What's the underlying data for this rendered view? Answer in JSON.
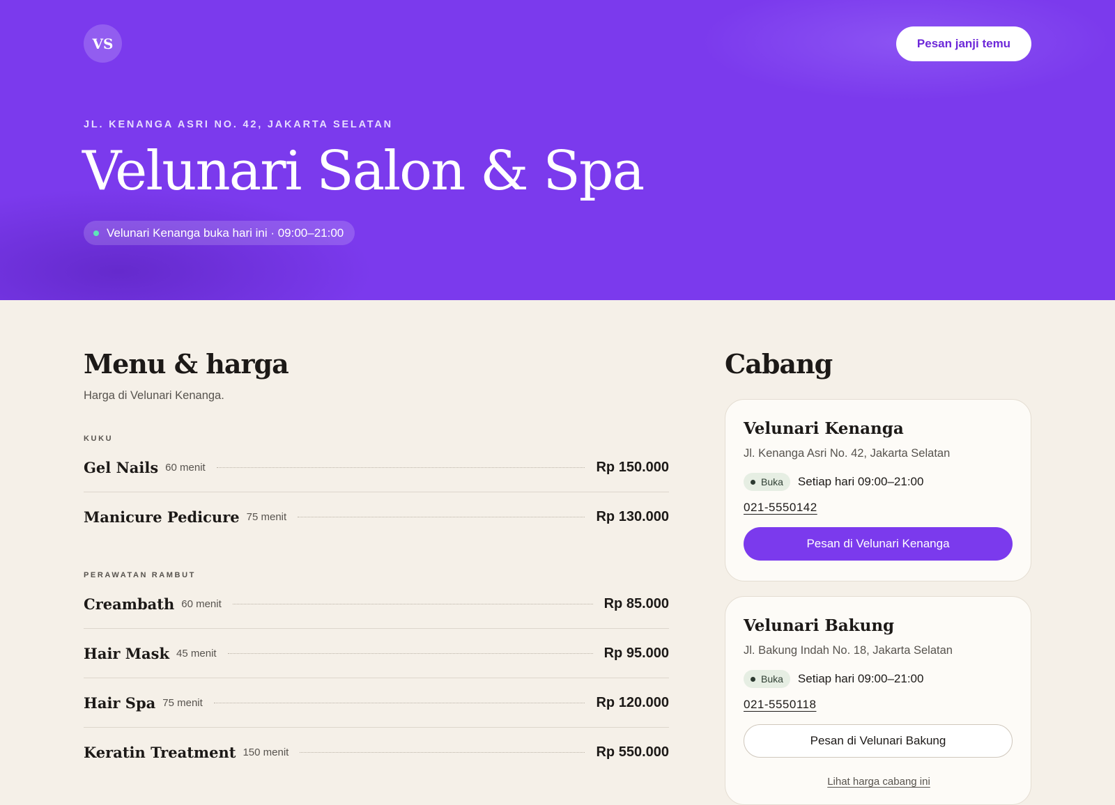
{
  "header": {
    "logo_text": "VS",
    "book_button": "Pesan janji temu",
    "address": "JL. KENANGA ASRI NO. 42, JAKARTA SELATAN",
    "title": "Velunari Salon & Spa",
    "open_status": "Velunari Kenanga buka hari ini · 09:00–21:00"
  },
  "menu": {
    "title": "Menu & harga",
    "subtitle": "Harga di Velunari Kenanga.",
    "categories": [
      {
        "label": "KUKU",
        "items": [
          {
            "name": "Gel Nails",
            "duration": "60 menit",
            "price": "Rp 150.000"
          },
          {
            "name": "Manicure Pedicure",
            "duration": "75 menit",
            "price": "Rp 130.000"
          }
        ]
      },
      {
        "label": "PERAWATAN RAMBUT",
        "items": [
          {
            "name": "Creambath",
            "duration": "60 menit",
            "price": "Rp 85.000"
          },
          {
            "name": "Hair Mask",
            "duration": "45 menit",
            "price": "Rp 95.000"
          },
          {
            "name": "Hair Spa",
            "duration": "75 menit",
            "price": "Rp 120.000"
          },
          {
            "name": "Keratin Treatment",
            "duration": "150 menit",
            "price": "Rp 550.000"
          }
        ]
      }
    ]
  },
  "branches": {
    "title": "Cabang",
    "items": [
      {
        "name": "Velunari Kenanga",
        "address": "Jl. Kenanga Asri No. 42, Jakarta Selatan",
        "status": "Buka",
        "hours": "Setiap hari 09:00–21:00",
        "phone": "021-5550142",
        "button": "Pesan di Velunari Kenanga"
      },
      {
        "name": "Velunari Bakung",
        "address": "Jl. Bakung Indah No. 18, Jakarta Selatan",
        "status": "Buka",
        "hours": "Setiap hari 09:00–21:00",
        "phone": "021-5550118",
        "button": "Pesan di Velunari Bakung",
        "price_link": "Lihat harga cabang ini"
      }
    ]
  },
  "colors": {
    "accent": "#7b3aed",
    "background": "#f5f0e8",
    "open_dot": "#5ee6b8"
  }
}
